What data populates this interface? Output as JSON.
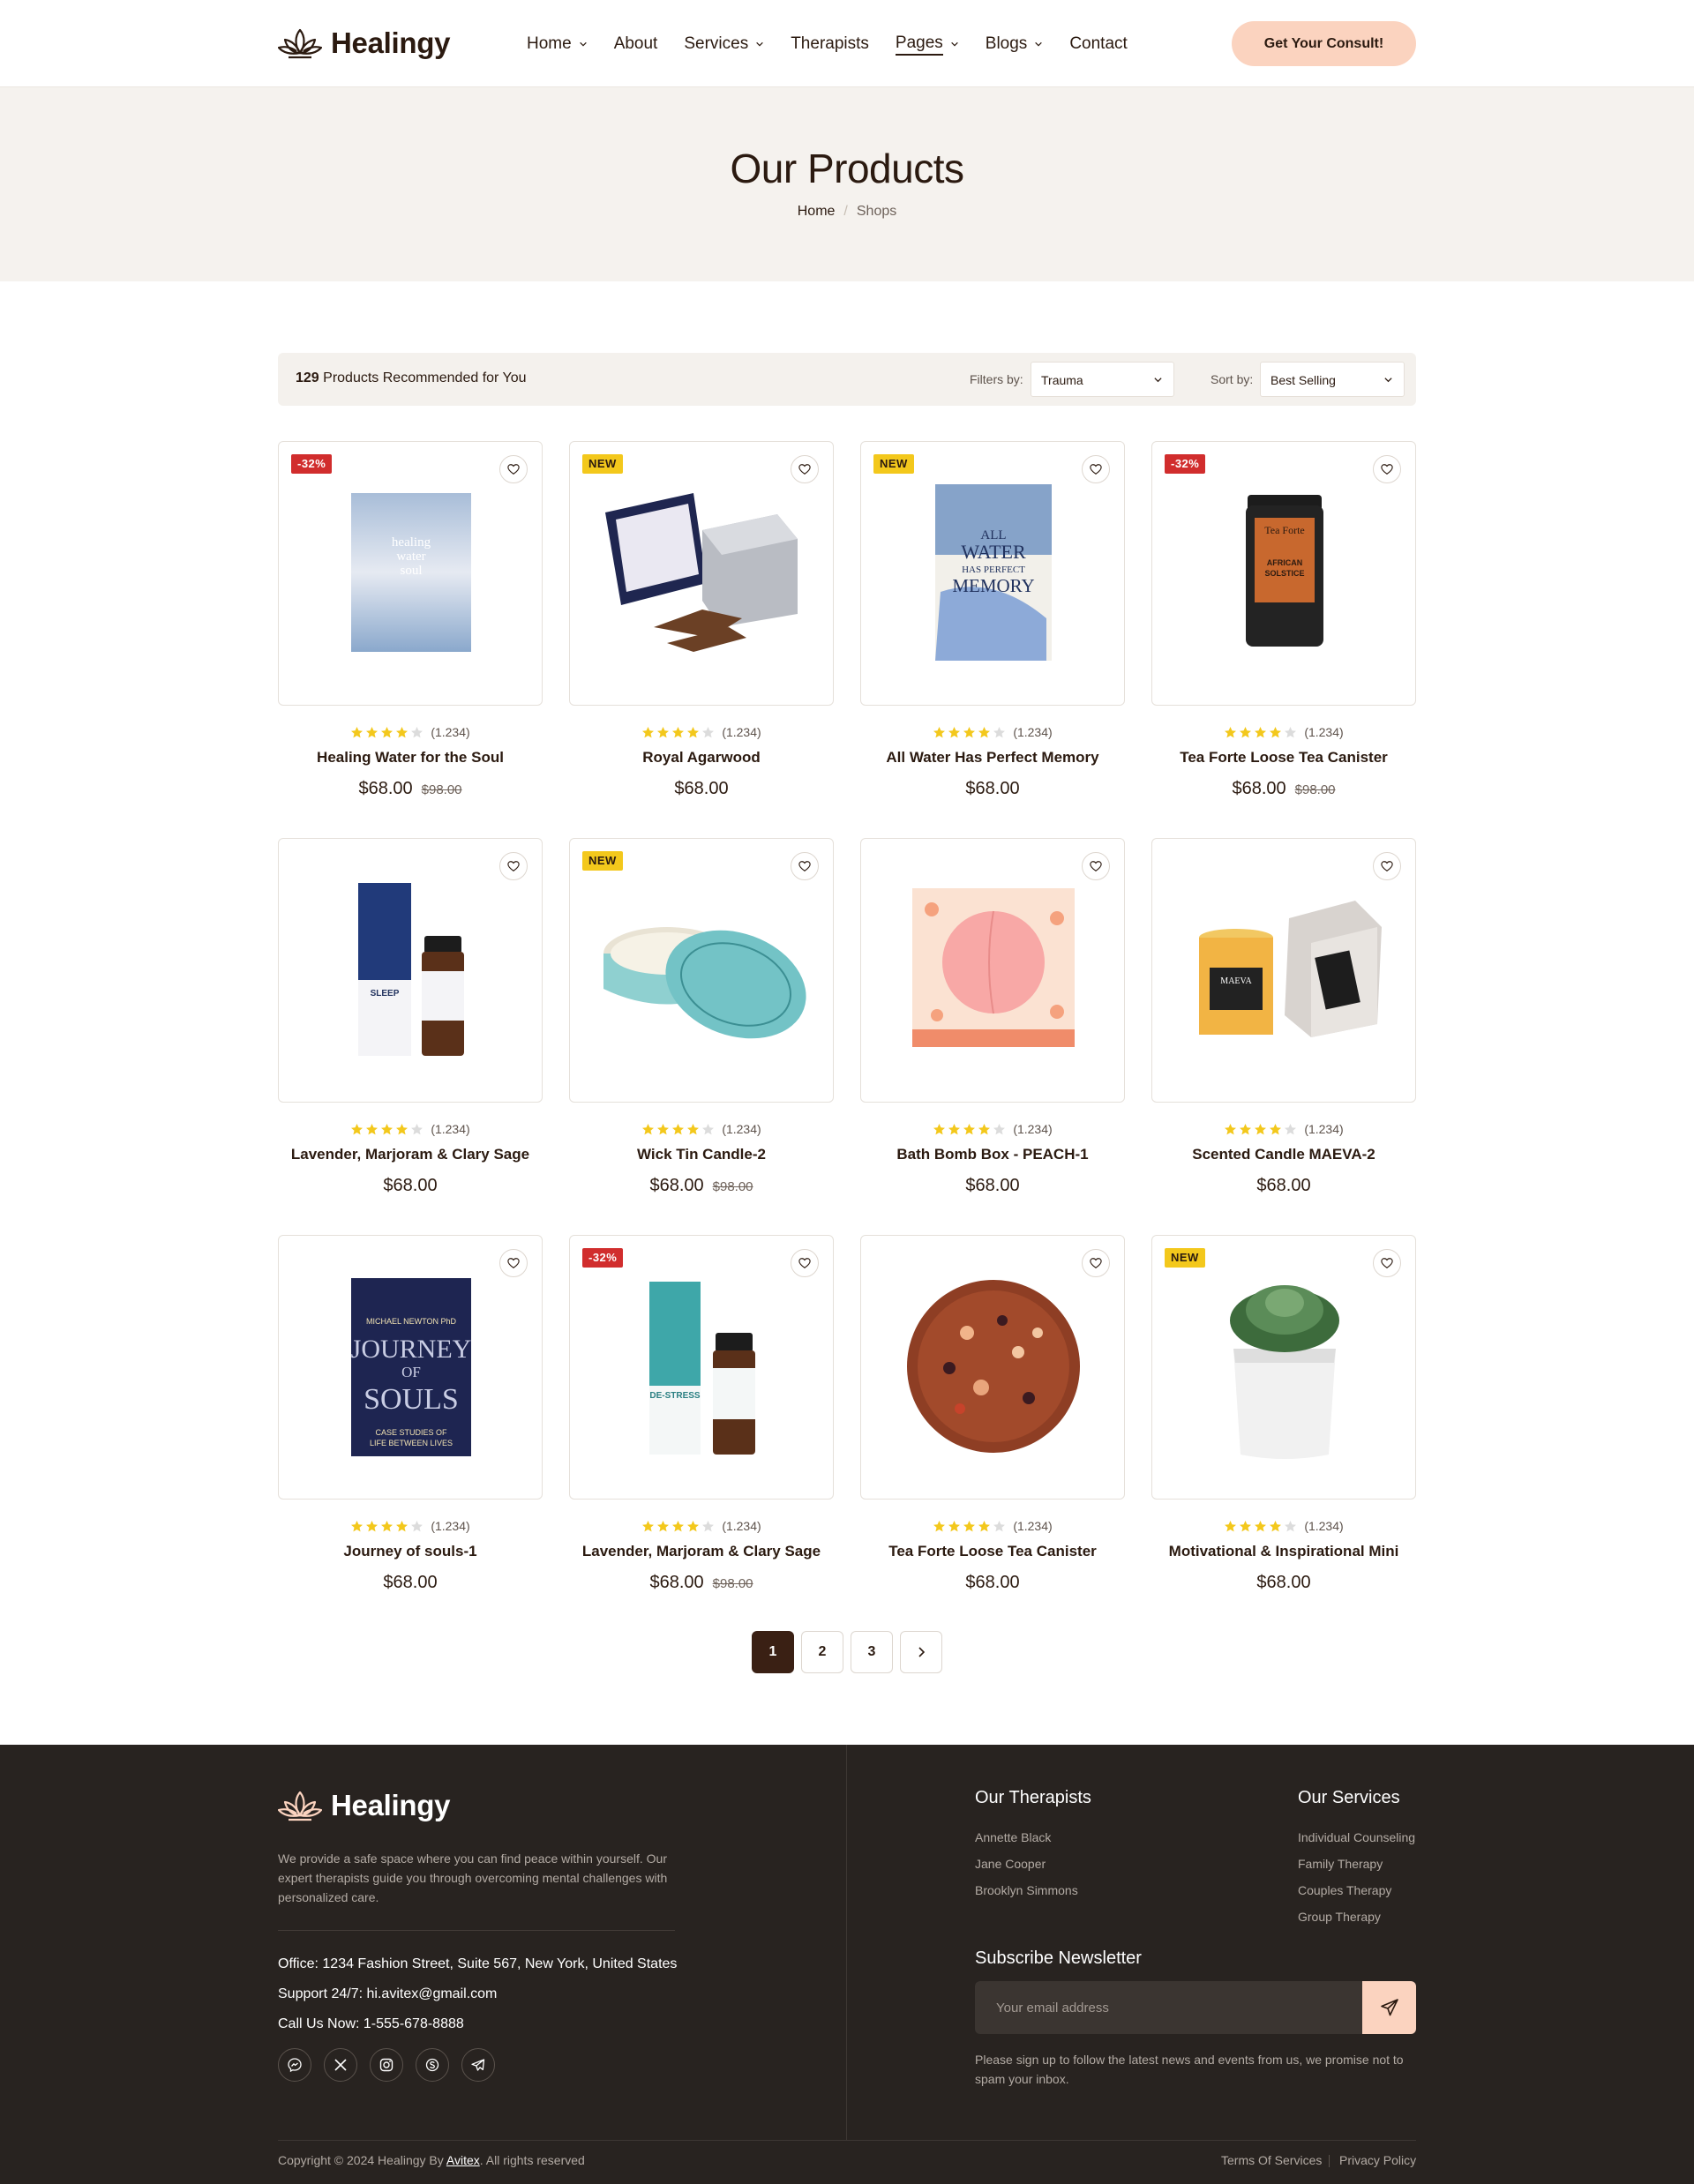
{
  "brand": {
    "name": "Healingy",
    "colors": {
      "primary": "#2b1a10",
      "accent": "#fbd3bf",
      "hero_bg": "#f5f2ee",
      "footer_bg": "#282320",
      "sale": "#d12d2d",
      "new": "#f3c81c",
      "star": "#f3c81c"
    }
  },
  "header": {
    "nav": [
      {
        "label": "Home",
        "dropdown": true
      },
      {
        "label": "About",
        "dropdown": false
      },
      {
        "label": "Services",
        "dropdown": true
      },
      {
        "label": "Therapists",
        "dropdown": false
      },
      {
        "label": "Pages",
        "dropdown": true,
        "active": true
      },
      {
        "label": "Blogs",
        "dropdown": true
      },
      {
        "label": "Contact",
        "dropdown": false
      }
    ],
    "cta": "Get Your Consult!"
  },
  "hero": {
    "title": "Our Products",
    "breadcrumb": {
      "home": "Home",
      "current": "Shops"
    }
  },
  "toolbar": {
    "count": "129",
    "count_text": "Products Recommended for You",
    "filter_label": "Filters by:",
    "filter_value": "Trauma",
    "sort_label": "Sort by:",
    "sort_value": "Best Selling"
  },
  "products": [
    {
      "name": "Healing Water for the Soul",
      "price": "$68.00",
      "old_price": "$98.00",
      "badge": "-32%",
      "badge_type": "sale",
      "rating": 4,
      "reviews": "(1.234)",
      "image": "book-healing-water"
    },
    {
      "name": "Royal Agarwood",
      "price": "$68.00",
      "old_price": "",
      "badge": "NEW",
      "badge_type": "new",
      "rating": 4,
      "reviews": "(1.234)",
      "image": "agarwood-box"
    },
    {
      "name": "All Water Has Perfect Memory",
      "price": "$68.00",
      "old_price": "",
      "badge": "NEW",
      "badge_type": "new",
      "rating": 4,
      "reviews": "(1.234)",
      "image": "book-all-water"
    },
    {
      "name": "Tea Forte Loose Tea Canister",
      "price": "$68.00",
      "old_price": "$98.00",
      "badge": "-32%",
      "badge_type": "sale",
      "rating": 4,
      "reviews": "(1.234)",
      "image": "tea-canister"
    },
    {
      "name": "Lavender, Marjoram & Clary Sage",
      "price": "$68.00",
      "old_price": "",
      "badge": "",
      "badge_type": "",
      "rating": 4,
      "reviews": "(1.234)",
      "image": "oil-sleep"
    },
    {
      "name": "Wick Tin Candle-2",
      "price": "$68.00",
      "old_price": "$98.00",
      "badge": "NEW",
      "badge_type": "new",
      "rating": 4,
      "reviews": "(1.234)",
      "image": "tin-candle"
    },
    {
      "name": "Bath Bomb Box - PEACH-1",
      "price": "$68.00",
      "old_price": "",
      "badge": "",
      "badge_type": "",
      "rating": 4,
      "reviews": "(1.234)",
      "image": "bath-bomb-peach"
    },
    {
      "name": "Scented Candle MAEVA-2",
      "price": "$68.00",
      "old_price": "",
      "badge": "",
      "badge_type": "",
      "rating": 4,
      "reviews": "(1.234)",
      "image": "candle-maeva"
    },
    {
      "name": "Journey of souls-1",
      "price": "$68.00",
      "old_price": "",
      "badge": "",
      "badge_type": "",
      "rating": 4,
      "reviews": "(1.234)",
      "image": "book-journey-of-souls"
    },
    {
      "name": "Lavender, Marjoram & Clary Sage",
      "price": "$68.00",
      "old_price": "$98.00",
      "badge": "-32%",
      "badge_type": "sale",
      "rating": 4,
      "reviews": "(1.234)",
      "image": "oil-de-stress"
    },
    {
      "name": "Tea Forte Loose Tea Canister",
      "price": "$68.00",
      "old_price": "",
      "badge": "",
      "badge_type": "",
      "rating": 4,
      "reviews": "(1.234)",
      "image": "loose-tea"
    },
    {
      "name": "Motivational & Inspirational Mini",
      "price": "$68.00",
      "old_price": "",
      "badge": "NEW",
      "badge_type": "new",
      "rating": 4,
      "reviews": "(1.234)",
      "image": "succulent-pot"
    }
  ],
  "image_text": {
    "book1_title": "healing water for the soul",
    "book2_title": "ALL WATER HAS PERFECT MEMORY",
    "tea_brand": "Tea Forte",
    "tea_flavor": "AFRICAN SOLSTICE",
    "oil1": "SLEEP",
    "candle_brand": "MAEVA",
    "book3_author": "MICHAEL NEWTON PhD",
    "book3_title_1": "JOURNEY",
    "book3_title_2": "OF",
    "book3_title_3": "SOULS",
    "book3_sub": "CASE STUDIES OF LIFE BETWEEN LIVES",
    "oil2": "DE-STRESS"
  },
  "pagination": {
    "pages": [
      "1",
      "2",
      "3"
    ],
    "current": "1"
  },
  "footer": {
    "description": "We provide a safe space where you can find peace within yourself. Our expert therapists guide you through overcoming mental challenges with personalized care.",
    "office": "Office: 1234 Fashion Street, Suite 567, New York, United States",
    "support": "Support 24/7: hi.avitex@gmail.com",
    "phone": "Call Us Now: 1-555-678-8888",
    "socials": [
      "messenger-icon",
      "x-icon",
      "instagram-icon",
      "skype-icon",
      "telegram-icon"
    ],
    "therapists_title": "Our Therapists",
    "therapists": [
      "Annette Black",
      "Jane Cooper",
      "Brooklyn Simmons"
    ],
    "services_title": "Our Services",
    "services": [
      "Individual Counseling",
      "Family Therapy",
      "Couples Therapy",
      "Group Therapy"
    ],
    "newsletter_title": "Subscribe Newsletter",
    "newsletter_placeholder": "Your email address",
    "newsletter_note": "Please sign up to follow the latest news and events from us, we promise not to spam your inbox.",
    "copyright_pre": "Copyright © 2024 Healingy By",
    "copyright_link": "Avitex",
    "copyright_post": ". All rights reserved",
    "terms": "Terms Of Services",
    "privacy": "Privacy Policy"
  }
}
